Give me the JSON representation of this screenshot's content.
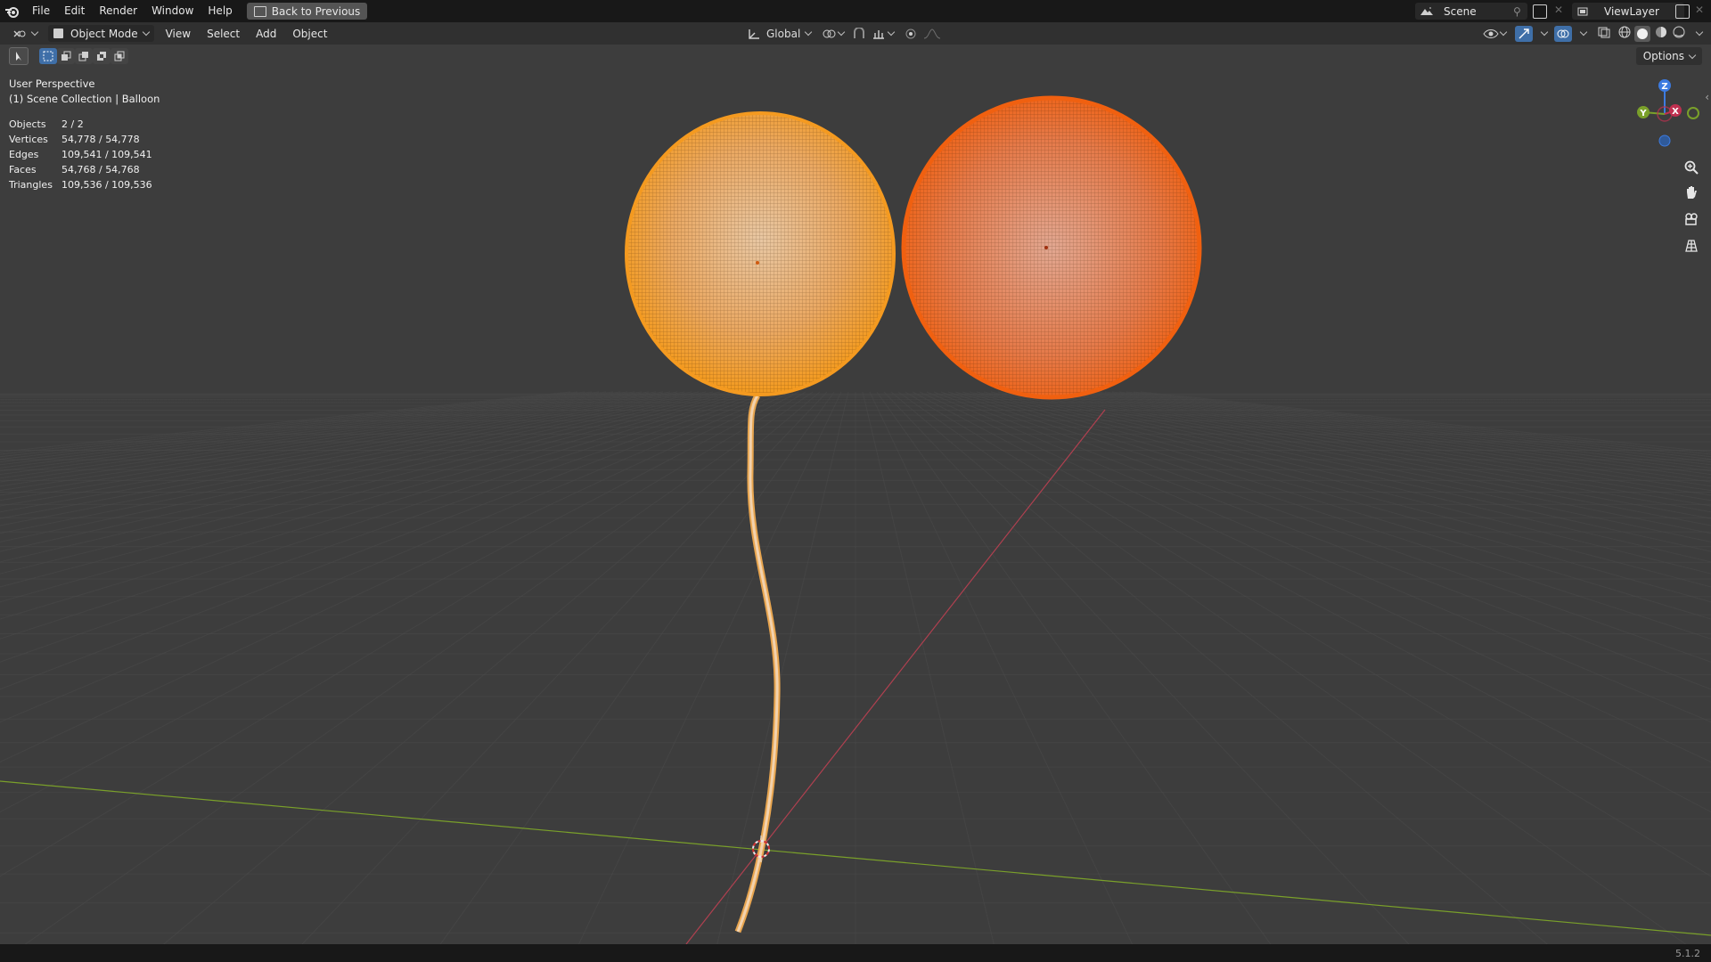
{
  "menu": [
    "File",
    "Edit",
    "Render",
    "Window",
    "Help"
  ],
  "back_button": "Back to Previous",
  "scene": "Scene",
  "view_layer": "ViewLayer",
  "header": {
    "mode": "Object Mode",
    "items": [
      "View",
      "Select",
      "Add",
      "Object"
    ],
    "orientation": "Global",
    "options": "Options"
  },
  "overlay": {
    "perspective": "User Perspective",
    "collection": "(1) Scene Collection | Balloon"
  },
  "stats": [
    {
      "label": "Objects",
      "value": "2 / 2"
    },
    {
      "label": "Vertices",
      "value": "54,778 / 54,778"
    },
    {
      "label": "Edges",
      "value": "109,541 / 109,541"
    },
    {
      "label": "Faces",
      "value": "54,768 / 54,768"
    },
    {
      "label": "Triangles",
      "value": "109,536 / 109,536"
    }
  ],
  "gizmo": {
    "z": "Z",
    "y": "Y",
    "x": "X"
  },
  "version": "5.1.2",
  "colors": {
    "balloon_left": "#f0a640",
    "balloon_right": "#e86a22",
    "axis_x": "#b04050",
    "axis_y": "#7aa02a"
  }
}
